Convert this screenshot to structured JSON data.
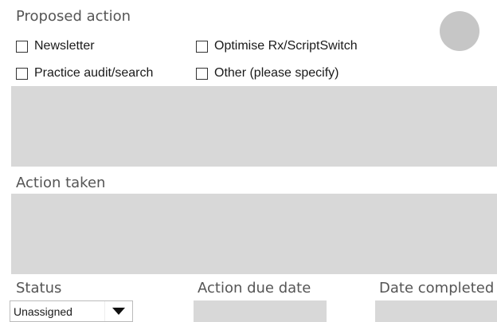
{
  "proposed_action": {
    "label": "Proposed action",
    "options": [
      {
        "label": "Newsletter"
      },
      {
        "label": "Optimise Rx/ScriptSwitch"
      },
      {
        "label": "Practice audit/search"
      },
      {
        "label": "Other (please specify)"
      }
    ]
  },
  "action_taken": {
    "label": "Action taken"
  },
  "status": {
    "label": "Status",
    "selected": "Unassigned"
  },
  "action_due_date": {
    "label": "Action due date"
  },
  "date_completed": {
    "label": "Date completed"
  },
  "colors": {
    "field_background": "#d8d8d8",
    "indicator_circle": "#c6c6c6",
    "label_text": "#555555"
  }
}
